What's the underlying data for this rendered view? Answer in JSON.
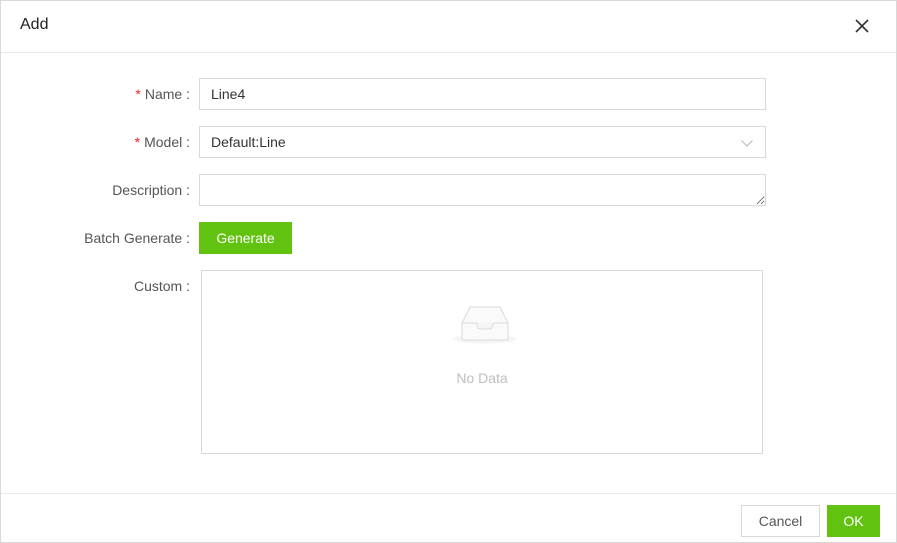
{
  "dialog": {
    "title": "Add"
  },
  "form": {
    "name": {
      "label": "Name :",
      "required_mark": "*",
      "value": "Line4"
    },
    "model": {
      "label": "Model :",
      "required_mark": "*",
      "selected": "Default:Line"
    },
    "description": {
      "label": "Description :",
      "value": ""
    },
    "batch_generate": {
      "label": "Batch Generate :",
      "button_label": "Generate"
    },
    "custom": {
      "label": "Custom :",
      "empty_text": "No Data"
    }
  },
  "footer": {
    "cancel_label": "Cancel",
    "ok_label": "OK"
  },
  "colors": {
    "accent": "#61c310",
    "required": "#f5222d",
    "border": "#d9d9d9"
  },
  "icons": {
    "close": "close-icon",
    "select_arrow": "chevron-down-icon",
    "empty": "empty-inbox-icon"
  }
}
